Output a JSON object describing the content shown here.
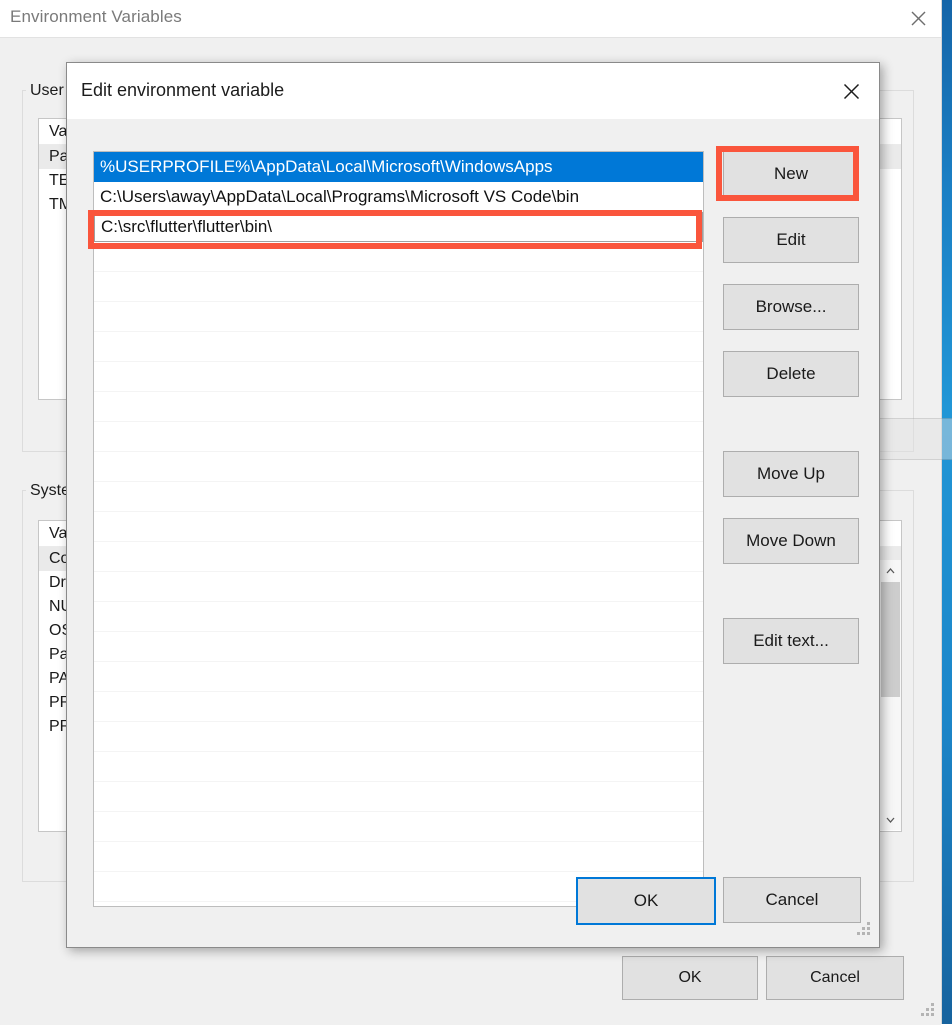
{
  "desktop": {
    "accent_color": "#1b7fc4"
  },
  "background_window": {
    "title": "Environment Variables",
    "close_icon": "close-icon",
    "user_group": {
      "label": "User",
      "list_header": "Var",
      "rows": [
        "Pat",
        "TE",
        "TM"
      ]
    },
    "system_group": {
      "label": "Syste",
      "list_header": "Var",
      "rows": [
        "Co",
        "Dri",
        "NU",
        "OS",
        "Pat",
        "PAT",
        "PR",
        "PR"
      ]
    },
    "ok_label": "OK",
    "cancel_label": "Cancel"
  },
  "dialog": {
    "title": "Edit environment variable",
    "close_icon": "close-icon",
    "selection_color": "#0078d7",
    "highlight_color": "#fa553c",
    "path_list": {
      "entries": [
        {
          "text": "%USERPROFILE%\\AppData\\Local\\Microsoft\\WindowsApps",
          "state": "selected"
        },
        {
          "text": "C:\\Users\\away\\AppData\\Local\\Programs\\Microsoft VS Code\\bin",
          "state": "normal"
        },
        {
          "text": "C:\\src\\flutter\\flutter\\bin\\",
          "state": "editing"
        }
      ],
      "empty_row_count": 22
    },
    "side_buttons": [
      {
        "label": "New",
        "highlighted": true
      },
      {
        "label": "Edit",
        "highlighted": false
      },
      {
        "label": "Browse...",
        "highlighted": false
      },
      {
        "label": "Delete",
        "highlighted": false
      },
      {
        "label": "Move Up",
        "highlighted": false
      },
      {
        "label": "Move Down",
        "highlighted": false
      },
      {
        "label": "Edit text...",
        "highlighted": false
      }
    ],
    "ok_label": "OK",
    "cancel_label": "Cancel"
  }
}
